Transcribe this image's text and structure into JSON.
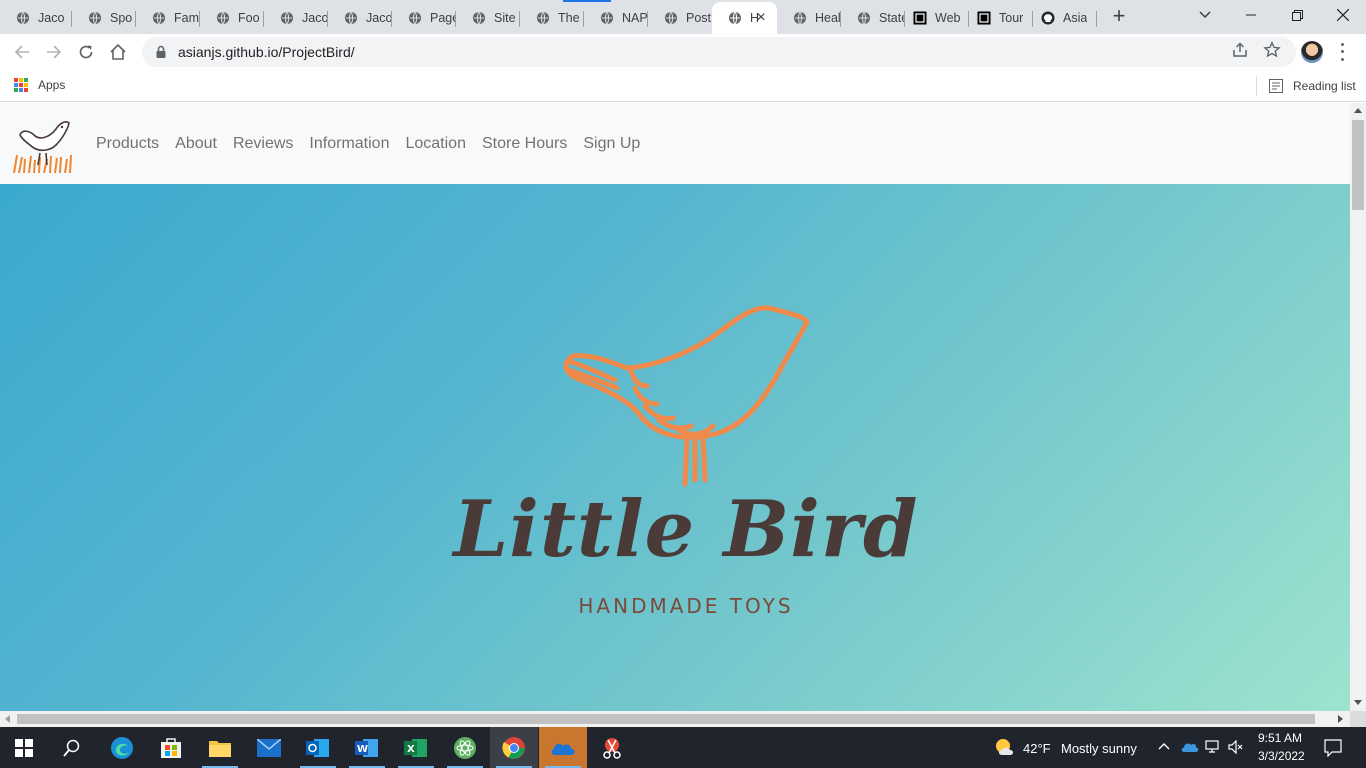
{
  "browser": {
    "tabs": [
      {
        "title": "Jaco"
      },
      {
        "title": "Spo"
      },
      {
        "title": "Fam"
      },
      {
        "title": "Foo"
      },
      {
        "title": "Jaco"
      },
      {
        "title": "Jaco"
      },
      {
        "title": "Page"
      },
      {
        "title": "Site"
      },
      {
        "title": "The"
      },
      {
        "title": "NAP"
      },
      {
        "title": "Post"
      },
      {
        "title": "H"
      },
      {
        "title": "Heal"
      },
      {
        "title": "State"
      },
      {
        "title": "Web"
      },
      {
        "title": "Tour"
      },
      {
        "title": "Asia"
      }
    ],
    "active_tab_index": 11,
    "url": "asianjs.github.io/ProjectBird/",
    "bookmarks_apps": "Apps",
    "reading_list": "Reading list"
  },
  "site": {
    "nav": [
      "Products",
      "About",
      "Reviews",
      "Information",
      "Location",
      "Store Hours",
      "Sign Up"
    ],
    "hero": {
      "title": "Little Bird",
      "subtitle": "HANDMADE TOYS"
    },
    "colors": {
      "accent": "#f08a4b",
      "title": "#4a3b38"
    }
  },
  "taskbar": {
    "weather_temp": "42°F",
    "weather_desc": "Mostly sunny",
    "time": "9:51 AM",
    "date": "3/3/2022"
  }
}
